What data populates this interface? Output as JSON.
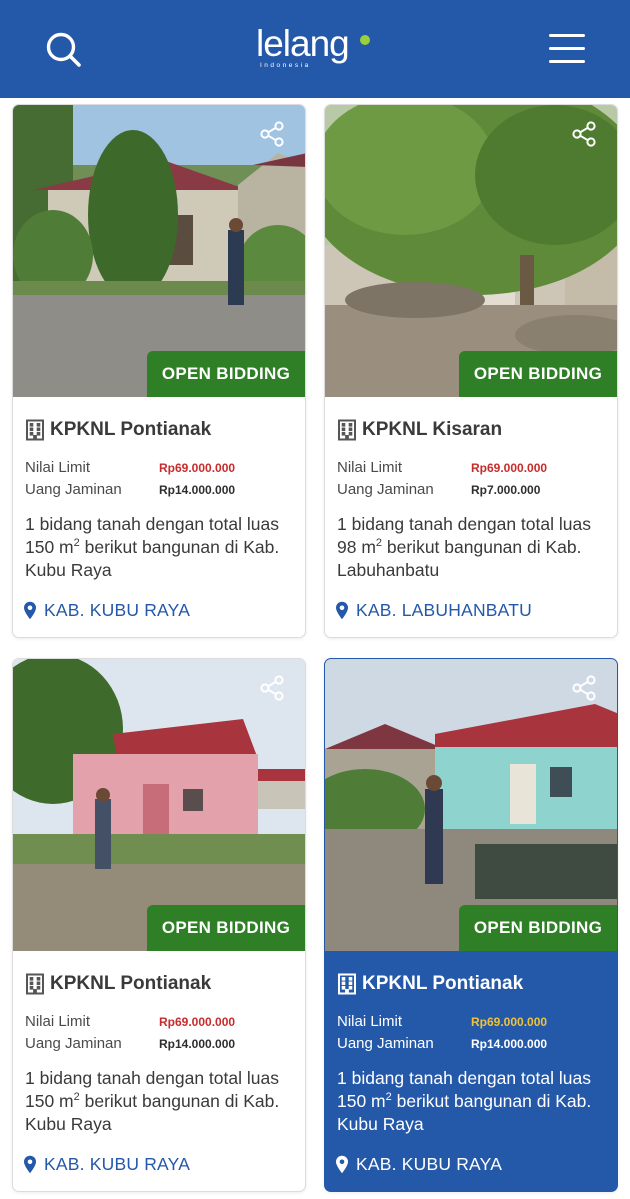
{
  "header": {
    "logo_text": "lelang",
    "logo_subtext": "Indonesia",
    "search_icon": "search-icon",
    "menu_icon": "hamburger-menu-icon",
    "brand_color": "#2458a8",
    "logo_accent": "#9ad13b"
  },
  "listings": [
    {
      "badge": "OPEN BIDDING",
      "office": "KPKNL Pontianak",
      "nilai_limit_label": "Nilai Limit",
      "nilai_limit_value": "Rp69.000.000",
      "uang_jaminan_label": "Uang Jaminan",
      "uang_jaminan_value": "Rp14.000.000",
      "desc_pre": "1 bidang tanah dengan total luas 150 m",
      "desc_sup": "2",
      "desc_post": " berikut bangunan di Kab. Kubu Raya",
      "location": "KAB. KUBU RAYA",
      "highlighted": false
    },
    {
      "badge": "OPEN BIDDING",
      "office": "KPKNL Kisaran",
      "nilai_limit_label": "Nilai Limit",
      "nilai_limit_value": "Rp69.000.000",
      "uang_jaminan_label": "Uang Jaminan",
      "uang_jaminan_value": "Rp7.000.000",
      "desc_pre": "1 bidang tanah dengan total luas 98 m",
      "desc_sup": "2",
      "desc_post": " berikut bangunan di Kab. Labuhanbatu",
      "location": "KAB. LABUHANBATU",
      "highlighted": false
    },
    {
      "badge": "OPEN BIDDING",
      "office": "KPKNL Pontianak",
      "nilai_limit_label": "Nilai Limit",
      "nilai_limit_value": "Rp69.000.000",
      "uang_jaminan_label": "Uang Jaminan",
      "uang_jaminan_value": "Rp14.000.000",
      "desc_pre": "1 bidang tanah dengan total luas 150 m",
      "desc_sup": "2",
      "desc_post": " berikut bangunan di Kab. Kubu Raya",
      "location": "KAB. KUBU RAYA",
      "highlighted": false
    },
    {
      "badge": "OPEN BIDDING",
      "office": "KPKNL Pontianak",
      "nilai_limit_label": "Nilai Limit",
      "nilai_limit_value": "Rp69.000.000",
      "uang_jaminan_label": "Uang Jaminan",
      "uang_jaminan_value": "Rp14.000.000",
      "desc_pre": "1 bidang tanah dengan total luas 150 m",
      "desc_sup": "2",
      "desc_post": " berikut bangunan di Kab. Kubu Raya",
      "location": "KAB. KUBU RAYA",
      "highlighted": true
    }
  ],
  "icons": {
    "share": "share-icon",
    "office": "building-icon",
    "location": "location-pin-icon"
  },
  "colors": {
    "badge_green": "#2f7f27",
    "limit_red": "#c82b2b",
    "limit_highlight": "#f0c23a",
    "link_blue": "#2458a8"
  }
}
